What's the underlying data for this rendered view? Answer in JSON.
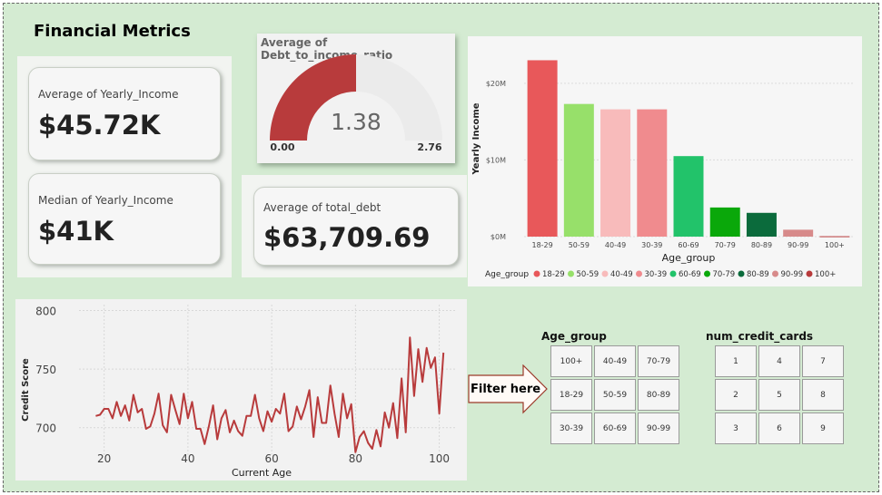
{
  "page": {
    "title": "Financial Metrics"
  },
  "kpis": {
    "avg_income": {
      "label": "Average of Yearly_Income",
      "value": "$45.72K"
    },
    "median_income": {
      "label": "Median of Yearly_Income",
      "value": "$41K"
    },
    "avg_debt": {
      "label": "Average of total_debt",
      "value": "$63,709.69"
    }
  },
  "gauge": {
    "title": "Average of Debt_to_income_ratio",
    "value": "1.38",
    "min": "0.00",
    "max": "2.76",
    "fill_fraction": 0.5,
    "color": "#b83b3c"
  },
  "bar_chart": {
    "ylabel": "Yearly Income",
    "xlabel": "Age_group",
    "yticks": [
      "$20M",
      "$10M",
      "$0M"
    ],
    "legend_title": "Age_group"
  },
  "line_chart": {
    "xlabel": "Current Age",
    "ylabel": "Credit Score",
    "yticks": [
      "800",
      "750",
      "700"
    ],
    "xticks": [
      "20",
      "40",
      "60",
      "80",
      "100"
    ],
    "color": "#b83b3c"
  },
  "filter": {
    "label": "Filter here"
  },
  "slicers": {
    "age_group": {
      "title": "Age_group",
      "options": [
        "100+",
        "40-49",
        "70-79",
        "18-29",
        "50-59",
        "80-89",
        "30-39",
        "60-69",
        "90-99"
      ]
    },
    "num_credit_cards": {
      "title": "num_credit_cards",
      "options": [
        "1",
        "4",
        "7",
        "2",
        "5",
        "8",
        "3",
        "6",
        "9"
      ]
    }
  },
  "chart_data": [
    {
      "type": "bar",
      "categories": [
        "18-29",
        "50-59",
        "40-49",
        "30-39",
        "60-69",
        "70-79",
        "80-89",
        "90-99",
        "100+"
      ],
      "values": [
        23000000,
        17300000,
        16600000,
        16600000,
        10500000,
        3800000,
        3100000,
        900000,
        50000
      ],
      "colors": [
        "#e8585a",
        "#97e06a",
        "#f8bbbb",
        "#f08b8e",
        "#22c36a",
        "#0aa80a",
        "#0b6b3c",
        "#d78a8a",
        "#b83b3c"
      ],
      "xlabel": "Age_group",
      "ylabel": "Yearly Income",
      "ylim": [
        0,
        24000000
      ],
      "legend": [
        "18-29",
        "50-59",
        "40-49",
        "30-39",
        "60-69",
        "70-79",
        "80-89",
        "90-99",
        "100+"
      ],
      "legend_position": "bottom"
    },
    {
      "type": "line",
      "x": [
        18,
        19,
        20,
        21,
        22,
        23,
        24,
        25,
        26,
        27,
        28,
        29,
        30,
        31,
        32,
        33,
        34,
        35,
        36,
        37,
        38,
        39,
        40,
        41,
        42,
        43,
        44,
        45,
        46,
        47,
        48,
        49,
        50,
        51,
        52,
        53,
        54,
        55,
        56,
        57,
        58,
        59,
        60,
        61,
        62,
        63,
        64,
        65,
        66,
        67,
        68,
        69,
        70,
        71,
        72,
        73,
        74,
        75,
        76,
        77,
        78,
        79,
        80,
        81,
        82,
        83,
        84,
        85,
        86,
        87,
        88,
        89,
        90,
        91,
        92,
        93,
        94,
        95,
        96,
        97,
        98,
        99,
        100,
        101
      ],
      "y": [
        710,
        711,
        716,
        716,
        708,
        722,
        710,
        719,
        706,
        728,
        713,
        716,
        699,
        701,
        712,
        729,
        702,
        696,
        728,
        715,
        703,
        729,
        708,
        722,
        699,
        699,
        686,
        701,
        719,
        690,
        708,
        715,
        696,
        706,
        697,
        693,
        710,
        710,
        728,
        708,
        697,
        714,
        705,
        716,
        712,
        729,
        697,
        701,
        718,
        707,
        718,
        732,
        692,
        726,
        704,
        704,
        736,
        712,
        692,
        729,
        708,
        720,
        679,
        692,
        697,
        687,
        682,
        698,
        684,
        713,
        700,
        721,
        691,
        742,
        696,
        777,
        727,
        767,
        739,
        768,
        751,
        760,
        712,
        764
      ],
      "xlabel": "Current Age",
      "ylabel": "Credit Score",
      "xlim": [
        14,
        104
      ],
      "ylim": [
        675,
        805
      ]
    }
  ]
}
